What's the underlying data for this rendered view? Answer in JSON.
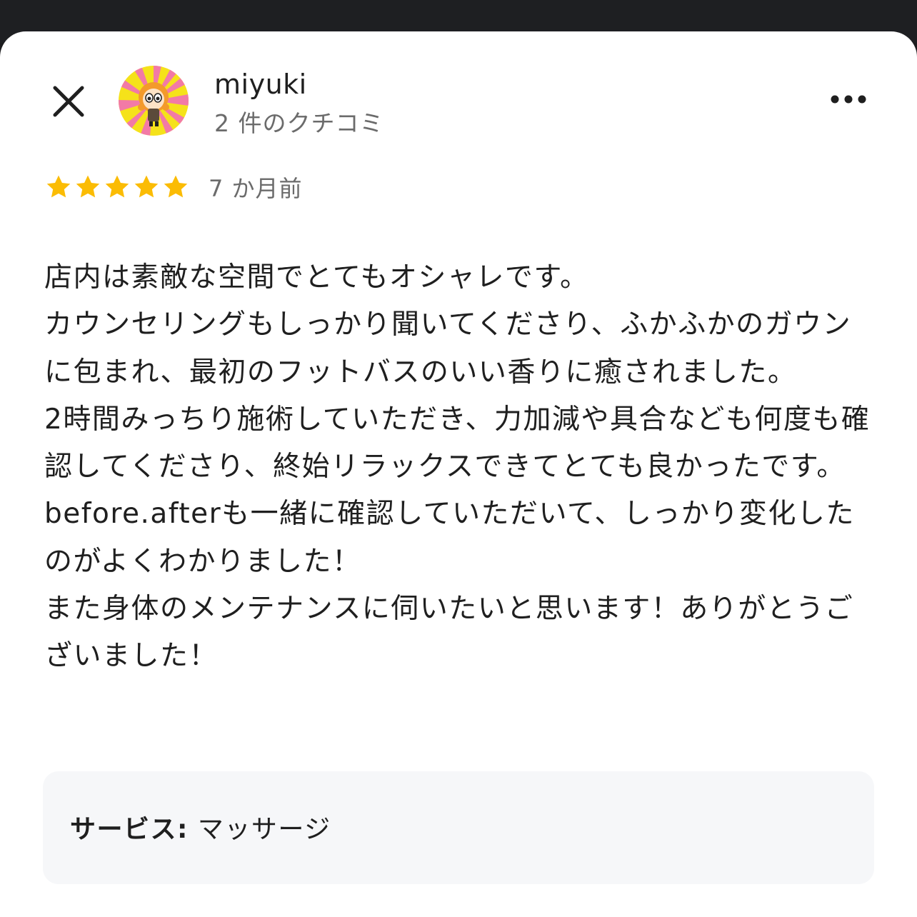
{
  "reviewer": {
    "name": "miyuki",
    "review_count": "2 件のクチコミ"
  },
  "review": {
    "rating": 5,
    "max_rating": 5,
    "time": "7 か月前",
    "text": "店内は素敵な空間でとてもオシャレです。\nカウンセリングもしっかり聞いてくださり、ふかふかのガウンに包まれ、最初のフットバスのいい香りに癒されました。\n2時間みっちり施術していただき、力加減や具合なども何度も確認してくださり、終始リラックスできてとても良かったです。\nbefore.afterも一緒に確認していただいて、しっかり変化したのがよくわかりました！\nまた身体のメンテナンスに伺いたいと思います！ありがとうございました！"
  },
  "service": {
    "label": "サービス:",
    "value": "マッサージ"
  },
  "icons": {
    "close": "close-icon",
    "more": "more-horizontal-icon",
    "star": "star-icon"
  },
  "colors": {
    "star": "#fbbc04",
    "text_primary": "#1f1f1f",
    "text_secondary": "#6b6b6b",
    "service_bg": "#f6f7f9",
    "top_bar": "#1e1f22"
  }
}
